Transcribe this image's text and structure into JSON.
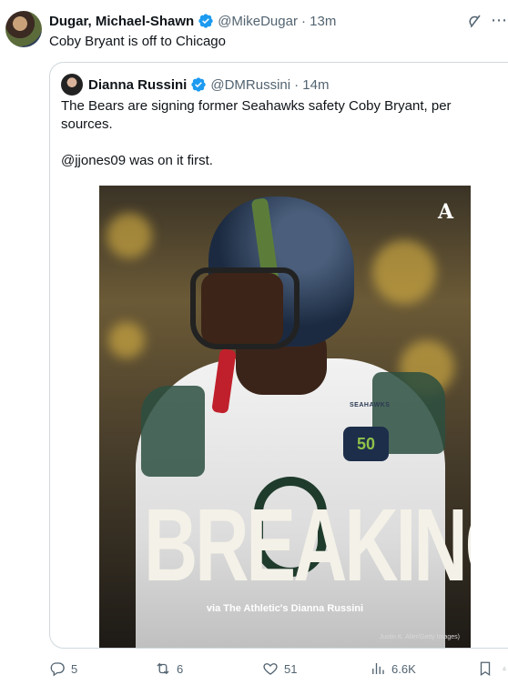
{
  "tweet": {
    "author_name": "Dugar, Michael-Shawn",
    "handle": "@MikeDugar",
    "time": "· 13m",
    "text": "Coby Bryant is off to Chicago"
  },
  "quote": {
    "author_name": "Dianna Russini",
    "handle": "@DMRussini",
    "time": "· 14m",
    "paragraphs": [
      "The Bears are signing former Seahawks safety Coby Bryant, per sources.",
      "@jjones09 was on it first."
    ],
    "media": {
      "logo": "A",
      "headline": "BREAKING",
      "subline": "via The Athletic's Dianna Russini",
      "photo_credit": "Justin K. Aller/Getty Images)",
      "jersey_text": "SEAHAWKS",
      "patch_text": "50"
    }
  },
  "actions": {
    "reply_count": "5",
    "retweet_count": "6",
    "like_count": "51",
    "view_count": "6.6K"
  },
  "icons": {
    "verified": "verified-badge-icon",
    "grok": "grok-icon",
    "more": "more-icon",
    "reply": "reply-icon",
    "retweet": "retweet-icon",
    "like": "heart-icon",
    "views": "views-icon",
    "bookmark": "bookmark-icon",
    "share": "share-icon"
  },
  "colors": {
    "verified": "#1d9bf0",
    "secondary_text": "#536471",
    "border": "#cfd9de"
  }
}
